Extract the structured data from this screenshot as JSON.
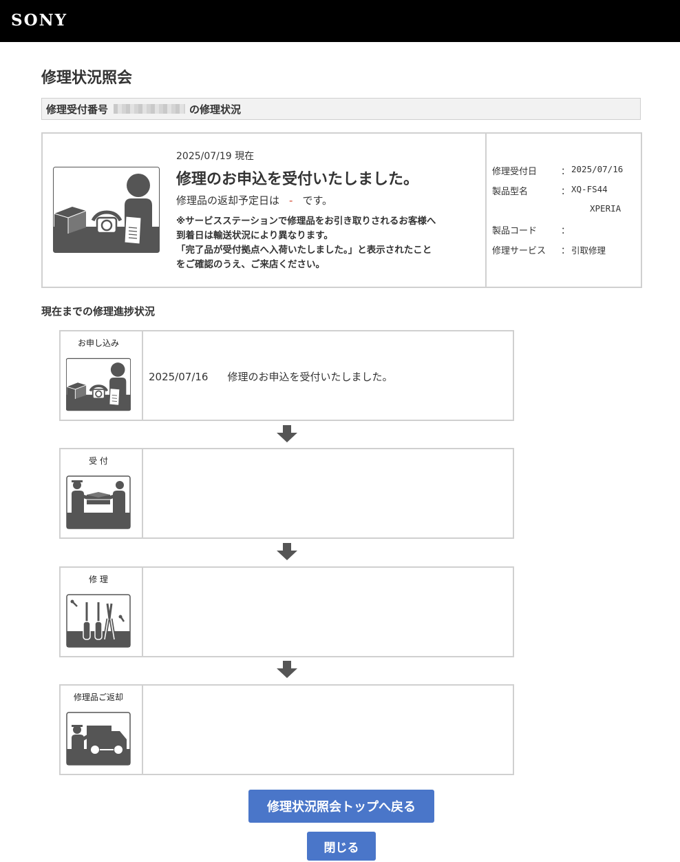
{
  "header": {
    "brand": "SONY"
  },
  "page_title": "修理状況照会",
  "receipt_bar": {
    "label": "修理受付番号",
    "suffix": "の修理状況"
  },
  "status": {
    "date": "2025/07/19 現在",
    "headline": "修理のお申込を受付いたしました。",
    "return_prefix": "修理品の返却予定日は",
    "return_value": "-",
    "return_suffix": "です。",
    "notice": [
      "※サービスステーションで修理品をお引き取りされるお客様へ",
      "到着日は輸送状況により異なります。",
      "「完了品が受付拠点へ入荷いたしました。」と表示されたこと",
      "をご確認のうえ、ご来店ください。"
    ]
  },
  "info": [
    {
      "label": "修理受付日",
      "sep": "：",
      "value": "2025/07/16"
    },
    {
      "label": "製品型名",
      "sep": "：",
      "value": "XQ-FS44",
      "value2": "XPERIA"
    },
    {
      "label": "製品コード",
      "sep": "：",
      "value": ""
    },
    {
      "label": "修理サービス",
      "sep": "：",
      "value": "引取修理"
    }
  ],
  "progress_title": "現在までの修理進捗状況",
  "steps": [
    {
      "label": "お申し込み",
      "icon": "application-icon",
      "date": "2025/07/16",
      "text": "修理のお申込を受付いたしました。"
    },
    {
      "label": "受 付",
      "icon": "reception-icon",
      "date": "",
      "text": ""
    },
    {
      "label": "修 理",
      "icon": "repair-tools-icon",
      "date": "",
      "text": ""
    },
    {
      "label": "修理品ご返却",
      "icon": "delivery-truck-icon",
      "date": "",
      "text": ""
    }
  ],
  "buttons": {
    "top": "修理状況照会トップへ戻る",
    "close": "閉じる"
  },
  "colors": {
    "header_bg": "#000000",
    "button": "#4a76c9",
    "icon_dark": "#555555"
  }
}
